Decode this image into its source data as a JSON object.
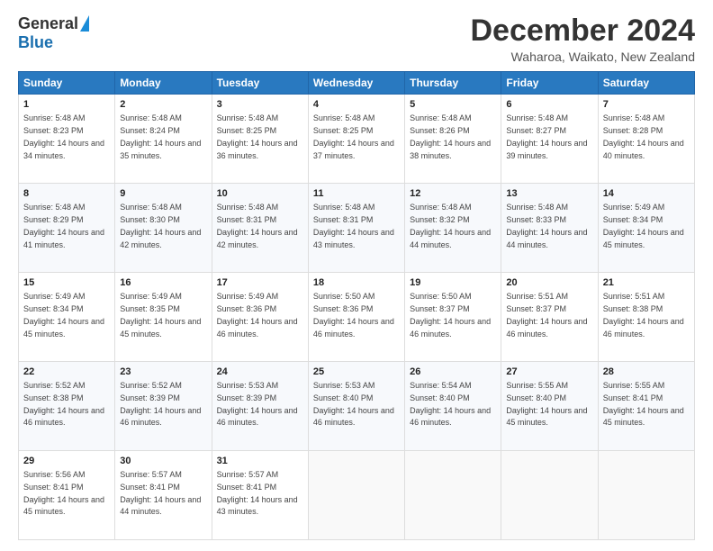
{
  "logo": {
    "general": "General",
    "blue": "Blue"
  },
  "title": "December 2024",
  "location": "Waharoa, Waikato, New Zealand",
  "days_header": [
    "Sunday",
    "Monday",
    "Tuesday",
    "Wednesday",
    "Thursday",
    "Friday",
    "Saturday"
  ],
  "weeks": [
    [
      {
        "day": "1",
        "sunrise": "5:48 AM",
        "sunset": "8:23 PM",
        "daylight": "14 hours and 34 minutes."
      },
      {
        "day": "2",
        "sunrise": "5:48 AM",
        "sunset": "8:24 PM",
        "daylight": "14 hours and 35 minutes."
      },
      {
        "day": "3",
        "sunrise": "5:48 AM",
        "sunset": "8:25 PM",
        "daylight": "14 hours and 36 minutes."
      },
      {
        "day": "4",
        "sunrise": "5:48 AM",
        "sunset": "8:25 PM",
        "daylight": "14 hours and 37 minutes."
      },
      {
        "day": "5",
        "sunrise": "5:48 AM",
        "sunset": "8:26 PM",
        "daylight": "14 hours and 38 minutes."
      },
      {
        "day": "6",
        "sunrise": "5:48 AM",
        "sunset": "8:27 PM",
        "daylight": "14 hours and 39 minutes."
      },
      {
        "day": "7",
        "sunrise": "5:48 AM",
        "sunset": "8:28 PM",
        "daylight": "14 hours and 40 minutes."
      }
    ],
    [
      {
        "day": "8",
        "sunrise": "5:48 AM",
        "sunset": "8:29 PM",
        "daylight": "14 hours and 41 minutes."
      },
      {
        "day": "9",
        "sunrise": "5:48 AM",
        "sunset": "8:30 PM",
        "daylight": "14 hours and 42 minutes."
      },
      {
        "day": "10",
        "sunrise": "5:48 AM",
        "sunset": "8:31 PM",
        "daylight": "14 hours and 42 minutes."
      },
      {
        "day": "11",
        "sunrise": "5:48 AM",
        "sunset": "8:31 PM",
        "daylight": "14 hours and 43 minutes."
      },
      {
        "day": "12",
        "sunrise": "5:48 AM",
        "sunset": "8:32 PM",
        "daylight": "14 hours and 44 minutes."
      },
      {
        "day": "13",
        "sunrise": "5:48 AM",
        "sunset": "8:33 PM",
        "daylight": "14 hours and 44 minutes."
      },
      {
        "day": "14",
        "sunrise": "5:49 AM",
        "sunset": "8:34 PM",
        "daylight": "14 hours and 45 minutes."
      }
    ],
    [
      {
        "day": "15",
        "sunrise": "5:49 AM",
        "sunset": "8:34 PM",
        "daylight": "14 hours and 45 minutes."
      },
      {
        "day": "16",
        "sunrise": "5:49 AM",
        "sunset": "8:35 PM",
        "daylight": "14 hours and 45 minutes."
      },
      {
        "day": "17",
        "sunrise": "5:49 AM",
        "sunset": "8:36 PM",
        "daylight": "14 hours and 46 minutes."
      },
      {
        "day": "18",
        "sunrise": "5:50 AM",
        "sunset": "8:36 PM",
        "daylight": "14 hours and 46 minutes."
      },
      {
        "day": "19",
        "sunrise": "5:50 AM",
        "sunset": "8:37 PM",
        "daylight": "14 hours and 46 minutes."
      },
      {
        "day": "20",
        "sunrise": "5:51 AM",
        "sunset": "8:37 PM",
        "daylight": "14 hours and 46 minutes."
      },
      {
        "day": "21",
        "sunrise": "5:51 AM",
        "sunset": "8:38 PM",
        "daylight": "14 hours and 46 minutes."
      }
    ],
    [
      {
        "day": "22",
        "sunrise": "5:52 AM",
        "sunset": "8:38 PM",
        "daylight": "14 hours and 46 minutes."
      },
      {
        "day": "23",
        "sunrise": "5:52 AM",
        "sunset": "8:39 PM",
        "daylight": "14 hours and 46 minutes."
      },
      {
        "day": "24",
        "sunrise": "5:53 AM",
        "sunset": "8:39 PM",
        "daylight": "14 hours and 46 minutes."
      },
      {
        "day": "25",
        "sunrise": "5:53 AM",
        "sunset": "8:40 PM",
        "daylight": "14 hours and 46 minutes."
      },
      {
        "day": "26",
        "sunrise": "5:54 AM",
        "sunset": "8:40 PM",
        "daylight": "14 hours and 46 minutes."
      },
      {
        "day": "27",
        "sunrise": "5:55 AM",
        "sunset": "8:40 PM",
        "daylight": "14 hours and 45 minutes."
      },
      {
        "day": "28",
        "sunrise": "5:55 AM",
        "sunset": "8:41 PM",
        "daylight": "14 hours and 45 minutes."
      }
    ],
    [
      {
        "day": "29",
        "sunrise": "5:56 AM",
        "sunset": "8:41 PM",
        "daylight": "14 hours and 45 minutes."
      },
      {
        "day": "30",
        "sunrise": "5:57 AM",
        "sunset": "8:41 PM",
        "daylight": "14 hours and 44 minutes."
      },
      {
        "day": "31",
        "sunrise": "5:57 AM",
        "sunset": "8:41 PM",
        "daylight": "14 hours and 43 minutes."
      },
      null,
      null,
      null,
      null
    ]
  ]
}
